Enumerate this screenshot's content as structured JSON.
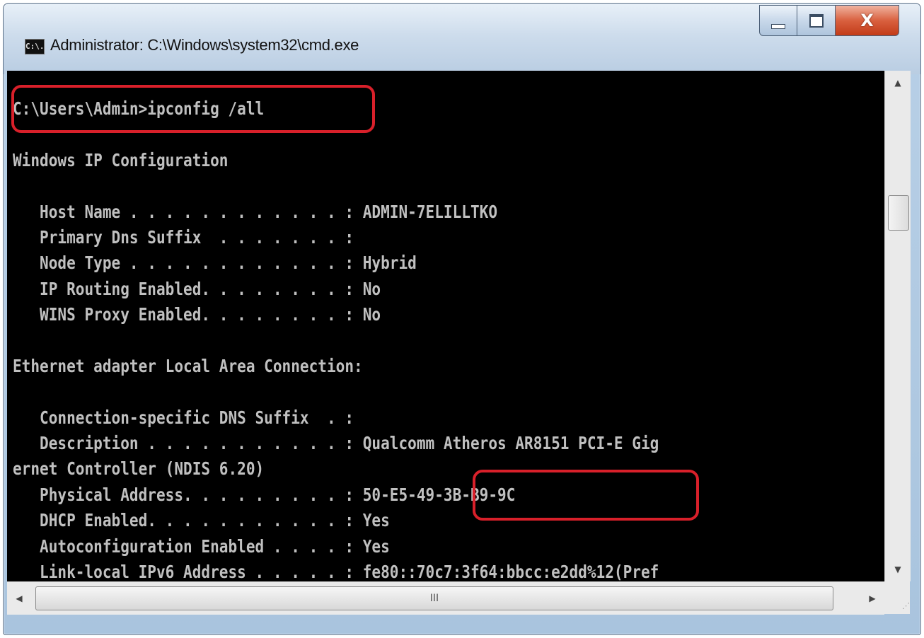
{
  "window": {
    "title": "Administrator: C:\\Windows\\system32\\cmd.exe",
    "icon_label": "C:\\.",
    "icon": "cmd-icon",
    "buttons": {
      "minimize_icon": "minimize-icon",
      "maximize_icon": "maximize-icon",
      "close_label": "X"
    }
  },
  "console": {
    "lines": [
      "C:\\Users\\Admin>ipconfig /all",
      "",
      "Windows IP Configuration",
      "",
      "   Host Name . . . . . . . . . . . . : ADMIN-7ELILLTKO",
      "   Primary Dns Suffix  . . . . . . . :",
      "   Node Type . . . . . . . . . . . . : Hybrid",
      "   IP Routing Enabled. . . . . . . . : No",
      "   WINS Proxy Enabled. . . . . . . . : No",
      "",
      "Ethernet adapter Local Area Connection:",
      "",
      "   Connection-specific DNS Suffix  . :",
      "   Description . . . . . . . . . . . : Qualcomm Atheros AR8151 PCI-E Gig",
      "ernet Controller (NDIS 6.20)",
      "   Physical Address. . . . . . . . . : 50-E5-49-3B-B9-9C",
      "   DHCP Enabled. . . . . . . . . . . : Yes",
      "   Autoconfiguration Enabled . . . . : Yes",
      "   Link-local IPv6 Address . . . . . : fe80::70c7:3f64:bbcc:e2dd%12(Pref"
    ],
    "text_color": "#c0c0c0",
    "background_color": "#000000",
    "highlight_color": "#d8202a"
  },
  "scrollbars": {
    "vertical": {
      "up_icon": "scroll-up-arrow-icon",
      "down_icon": "scroll-down-arrow-icon"
    },
    "horizontal": {
      "left_icon": "scroll-left-arrow-icon",
      "right_icon": "scroll-right-arrow-icon",
      "thumb_grip": "III"
    }
  }
}
